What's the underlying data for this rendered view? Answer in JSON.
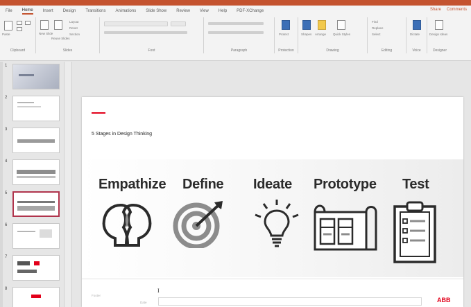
{
  "ribbon": {
    "tabs": [
      "File",
      "Home",
      "Insert",
      "Design",
      "Transitions",
      "Animations",
      "Slide Show",
      "Review",
      "View",
      "Help",
      "PDF-XChange"
    ],
    "active_tab": "Home",
    "share_label": "Share",
    "comments_label": "Comments",
    "groups": {
      "clipboard": "Clipboard",
      "slides": "Slides",
      "font": "Font",
      "paragraph": "Paragraph",
      "protection": "Protection",
      "drawing": "Drawing",
      "editing": "Editing",
      "voice": "Voice",
      "designer": "Designer"
    },
    "buttons": {
      "paste": "Paste",
      "new_slide": "New Slide",
      "reuse_slides": "Reuse Slides",
      "layout": "Layout",
      "reset": "Reset",
      "section": "Section",
      "protect": "Protect",
      "shapes": "Shapes",
      "arrange": "Arrange",
      "quick_styles": "Quick Styles",
      "find": "Find",
      "replace": "Replace",
      "select": "Select",
      "dictate": "Dictate",
      "design_ideas": "Design Ideas"
    }
  },
  "thumbnails": {
    "numbers": [
      "1",
      "2",
      "3",
      "4",
      "5",
      "6",
      "7",
      "8"
    ],
    "selected_index": 5
  },
  "slide": {
    "title": "5 Stages in Design Thinking",
    "stages": [
      {
        "label": "Empathize",
        "icon": "two-heads-icon"
      },
      {
        "label": "Define",
        "icon": "target-icon"
      },
      {
        "label": "Ideate",
        "icon": "lightbulb-icon"
      },
      {
        "label": "Prototype",
        "icon": "blueprint-icon"
      },
      {
        "label": "Test",
        "icon": "clipboard-checklist-icon"
      }
    ],
    "footer_left": "Footer",
    "footer_date": "Date",
    "footer_logo": "ABB"
  },
  "colors": {
    "accent": "#c4532f",
    "brand_red": "#e2001a",
    "selection": "#b0344c",
    "icon_gray": "#2b2b2b"
  }
}
